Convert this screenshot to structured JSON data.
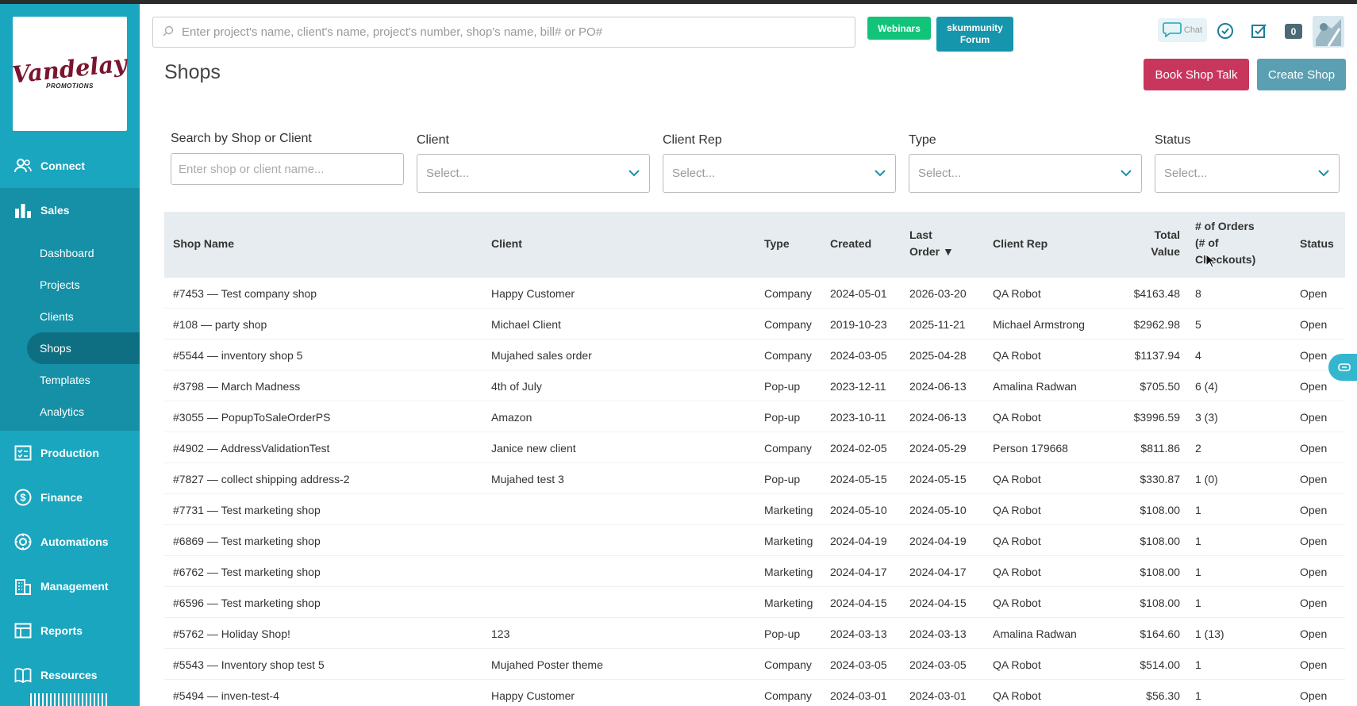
{
  "brand": {
    "logo_main": "Vandelay",
    "logo_sub": "PROMOTIONS"
  },
  "sidebar": {
    "connect": "Connect",
    "sales": "Sales",
    "sales_items": [
      "Dashboard",
      "Projects",
      "Clients",
      "Shops",
      "Templates",
      "Analytics"
    ],
    "active_item": "Shops",
    "production": "Production",
    "finance": "Finance",
    "automations": "Automations",
    "management": "Management",
    "reports": "Reports",
    "resources": "Resources"
  },
  "header": {
    "search_placeholder": "Enter project's name, client's name, project's number, shop's name, bill# or PO#",
    "webinars": "Webinars",
    "forum_line1": "skummunity",
    "forum_line2": "Forum",
    "chat": "Chat",
    "notif_count": "0"
  },
  "page": {
    "title": "Shops",
    "book_button": "Book Shop Talk",
    "create_button": "Create Shop"
  },
  "filters": {
    "search_label": "Search by Shop or Client",
    "search_placeholder": "Enter shop or client name...",
    "client_label": "Client",
    "client_value": "Select...",
    "rep_label": "Client Rep",
    "rep_value": "Select...",
    "type_label": "Type",
    "type_value": "Select...",
    "status_label": "Status",
    "status_value": "Select..."
  },
  "table": {
    "headers": {
      "shop_name": "Shop Name",
      "client": "Client",
      "type": "Type",
      "created": "Created",
      "last_order_1": "Last",
      "last_order_2": "Order",
      "sort_indicator": "▼",
      "client_rep": "Client Rep",
      "total_1": "Total",
      "total_2": "Value",
      "orders_1": "# of Orders",
      "orders_2": "(# of",
      "orders_3": "Checkouts)",
      "status": "Status"
    },
    "rows": [
      {
        "shop": "#7453 — Test company shop",
        "client": "Happy Customer",
        "type": "Company",
        "created": "2024-05-01",
        "last": "2026-03-20",
        "rep": "QA Robot",
        "total": "$4163.48",
        "orders": "8",
        "status": "Open"
      },
      {
        "shop": "#108 — party shop",
        "client": "Michael Client",
        "type": "Company",
        "created": "2019-10-23",
        "last": "2025-11-21",
        "rep": "Michael Armstrong",
        "total": "$2962.98",
        "orders": "5",
        "status": "Open"
      },
      {
        "shop": "#5544 — inventory shop 5",
        "client": "Mujahed sales order",
        "type": "Company",
        "created": "2024-03-05",
        "last": "2025-04-28",
        "rep": "QA Robot",
        "total": "$1137.94",
        "orders": "4",
        "status": "Open"
      },
      {
        "shop": "#3798 — March Madness",
        "client": "4th of July",
        "type": "Pop-up",
        "created": "2023-12-11",
        "last": "2024-06-13",
        "rep": "Amalina Radwan",
        "total": "$705.50",
        "orders": "6 (4)",
        "status": "Open"
      },
      {
        "shop": "#3055 — PopupToSaleOrderPS",
        "client": "Amazon",
        "type": "Pop-up",
        "created": "2023-10-11",
        "last": "2024-06-13",
        "rep": "QA Robot",
        "total": "$3996.59",
        "orders": "3 (3)",
        "status": "Open"
      },
      {
        "shop": "#4902 — AddressValidationTest",
        "client": "Janice new client",
        "type": "Company",
        "created": "2024-02-05",
        "last": "2024-05-29",
        "rep": "Person 179668",
        "total": "$811.86",
        "orders": "2",
        "status": "Open"
      },
      {
        "shop": "#7827 — collect shipping address-2",
        "client": "Mujahed test 3",
        "type": "Pop-up",
        "created": "2024-05-15",
        "last": "2024-05-15",
        "rep": "QA Robot",
        "total": "$330.87",
        "orders": "1 (0)",
        "status": "Open"
      },
      {
        "shop": "#7731 — Test marketing shop",
        "client": "",
        "type": "Marketing",
        "created": "2024-05-10",
        "last": "2024-05-10",
        "rep": "QA Robot",
        "total": "$108.00",
        "orders": "1",
        "status": "Open"
      },
      {
        "shop": "#6869 — Test marketing shop",
        "client": "",
        "type": "Marketing",
        "created": "2024-04-19",
        "last": "2024-04-19",
        "rep": "QA Robot",
        "total": "$108.00",
        "orders": "1",
        "status": "Open"
      },
      {
        "shop": "#6762 — Test marketing shop",
        "client": "",
        "type": "Marketing",
        "created": "2024-04-17",
        "last": "2024-04-17",
        "rep": "QA Robot",
        "total": "$108.00",
        "orders": "1",
        "status": "Open"
      },
      {
        "shop": "#6596 — Test marketing shop",
        "client": "",
        "type": "Marketing",
        "created": "2024-04-15",
        "last": "2024-04-15",
        "rep": "QA Robot",
        "total": "$108.00",
        "orders": "1",
        "status": "Open"
      },
      {
        "shop": "#5762 — Holiday Shop!",
        "client": "123",
        "type": "Pop-up",
        "created": "2024-03-13",
        "last": "2024-03-13",
        "rep": "Amalina Radwan",
        "total": "$164.60",
        "orders": "1 (13)",
        "status": "Open"
      },
      {
        "shop": "#5543 — Inventory shop test 5",
        "client": "Mujahed Poster theme",
        "type": "Company",
        "created": "2024-03-05",
        "last": "2024-03-05",
        "rep": "QA Robot",
        "total": "$514.00",
        "orders": "1",
        "status": "Open"
      },
      {
        "shop": "#5494 — inven-test-4",
        "client": "Happy Customer",
        "type": "Company",
        "created": "2024-03-01",
        "last": "2024-03-01",
        "rep": "QA Robot",
        "total": "$56.30",
        "orders": "1",
        "status": "Open"
      }
    ]
  },
  "colors": {
    "sidebar": "#1aa6bf",
    "sidebar_sales": "#1590a6",
    "active_item": "#0f6f82",
    "book_button": "#c8365e",
    "create_button": "#5b9fb3",
    "webinars": "#12c37a",
    "forum": "#1596ad",
    "table_header": "#e6ecef"
  },
  "icons": [
    "search-icon",
    "connect-icon",
    "sales-icon",
    "production-icon",
    "finance-icon",
    "automations-icon",
    "management-icon",
    "reports-icon",
    "resources-icon",
    "chat-icon",
    "clock-check-icon",
    "task-icon",
    "avatar-image",
    "chevron-down-icon",
    "help-widget-icon"
  ]
}
